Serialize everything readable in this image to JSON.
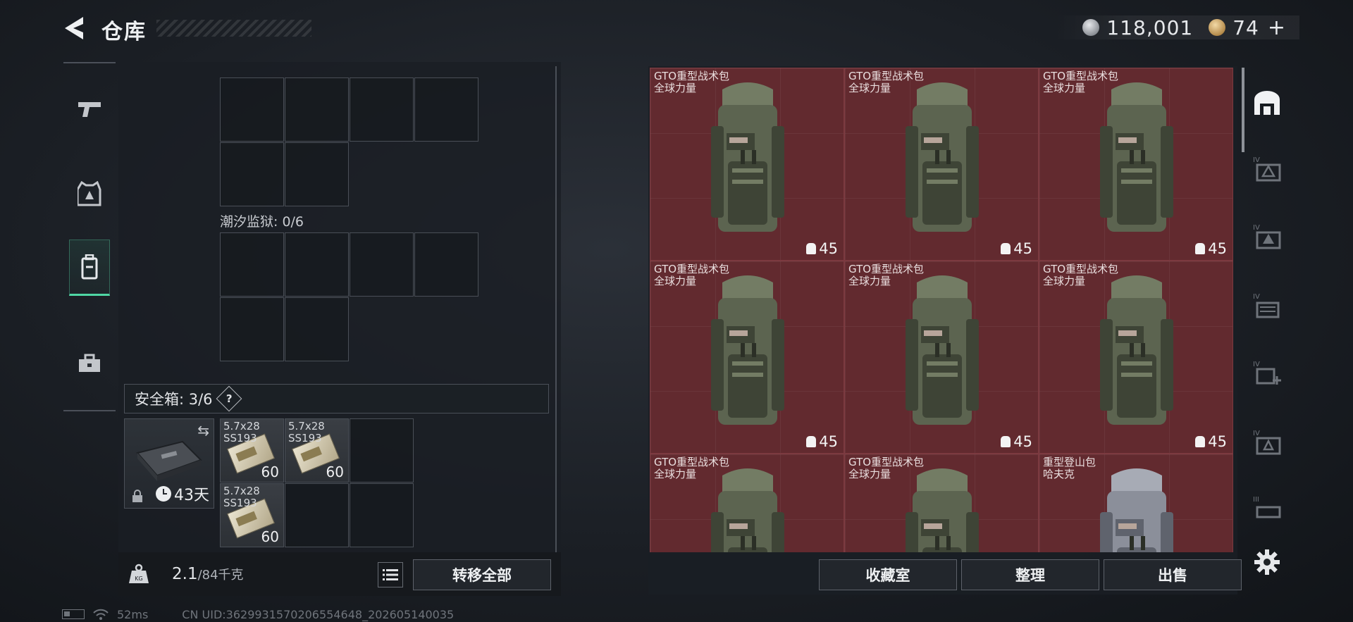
{
  "header": {
    "title": "仓库",
    "currencies": [
      {
        "icon": "silver-coin-icon",
        "value": "118,001"
      },
      {
        "icon": "gold-coin-icon",
        "value": "74",
        "add": "+"
      }
    ]
  },
  "rail": {
    "items": [
      {
        "icon": "pistol-icon",
        "active": false
      },
      {
        "icon": "armor-icon",
        "active": false
      },
      {
        "icon": "backpack-icon",
        "active": true
      },
      {
        "icon": "toolbox-icon",
        "active": false
      }
    ]
  },
  "left": {
    "prison_label": "潮汐监狱: 0/6",
    "safe_label": "安全箱: 3/6",
    "help": "?",
    "safe_days": "43天",
    "ammo": [
      {
        "name": "5.7x28\nSS193",
        "count": "60"
      },
      {
        "name": "5.7x28\nSS193",
        "count": "60"
      },
      {
        "name": "5.7x28\nSS193",
        "count": "60"
      }
    ],
    "weight_current": "2.1",
    "weight_max": "/84千克",
    "transfer_label": "转移全部"
  },
  "stash": {
    "items": [
      {
        "name": "GTO重型战术包",
        "brand": "全球力量",
        "count": "45",
        "color": "green"
      },
      {
        "name": "GTO重型战术包",
        "brand": "全球力量",
        "count": "45",
        "color": "green"
      },
      {
        "name": "GTO重型战术包",
        "brand": "全球力量",
        "count": "45",
        "color": "green"
      },
      {
        "name": "GTO重型战术包",
        "brand": "全球力量",
        "count": "45",
        "color": "green"
      },
      {
        "name": "GTO重型战术包",
        "brand": "全球力量",
        "count": "45",
        "color": "green"
      },
      {
        "name": "GTO重型战术包",
        "brand": "全球力量",
        "count": "45",
        "color": "green"
      },
      {
        "name": "GTO重型战术包",
        "brand": "全球力量",
        "count": "",
        "color": "green"
      },
      {
        "name": "GTO重型战术包",
        "brand": "全球力量",
        "count": "",
        "color": "green"
      },
      {
        "name": "重型登山包",
        "brand": "哈夫克",
        "count": "",
        "color": "grey"
      }
    ],
    "buttons": {
      "collection": "收藏室",
      "sort": "整理",
      "sell": "出售"
    }
  },
  "status": {
    "ping": "52ms",
    "uid": "CN UID:3629931570206554648_202605140035"
  },
  "colors": {
    "card_bg": "#622a2f",
    "accent": "#4fd7a4"
  }
}
